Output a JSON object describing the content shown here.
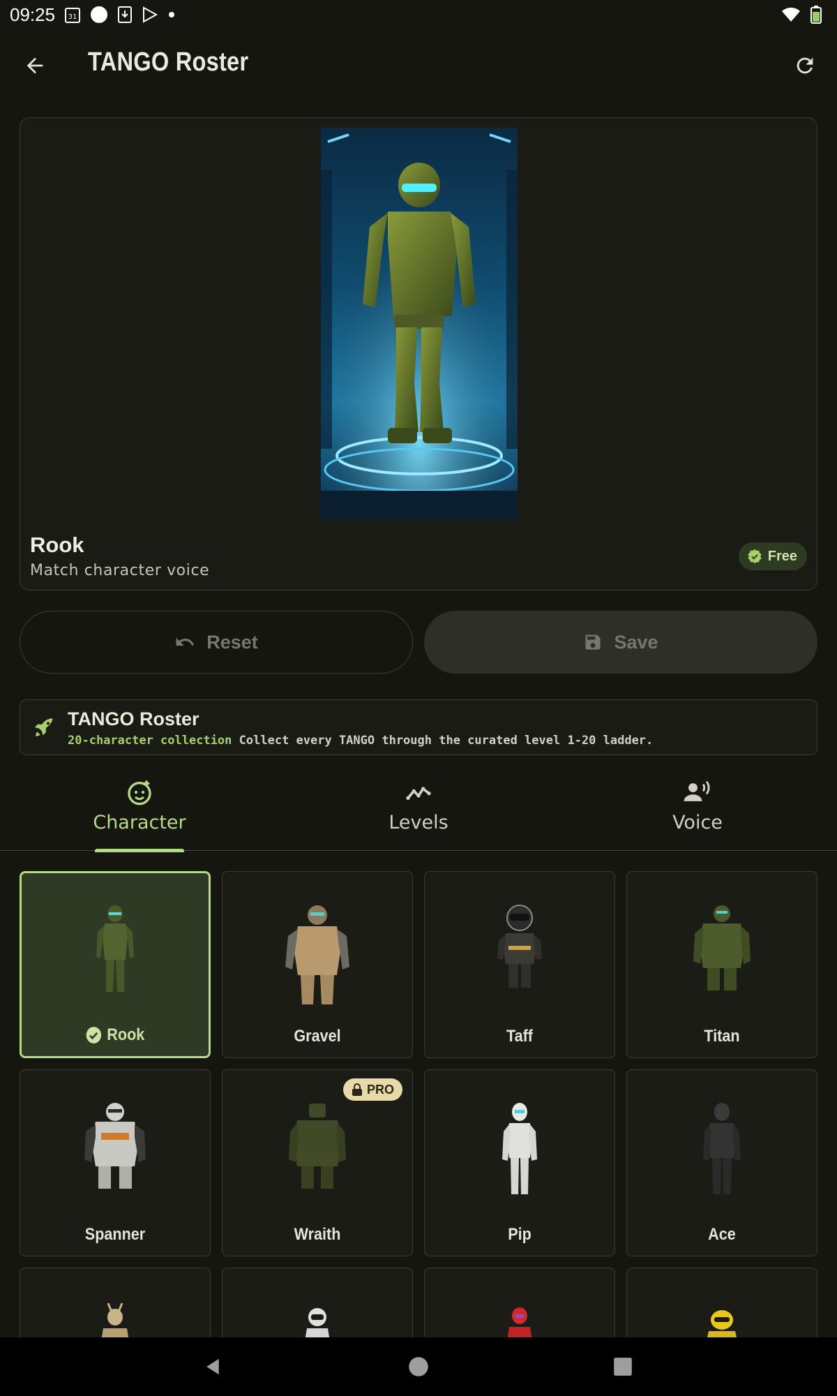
{
  "status_bar": {
    "time": "09:25",
    "icons": [
      "calendar-icon",
      "circle-icon",
      "download-icon",
      "play-store-icon",
      "dot-icon",
      "wifi-icon",
      "battery-icon"
    ]
  },
  "app_bar": {
    "title": "TANGO Roster",
    "back_icon": "arrow-left-icon",
    "refresh_icon": "refresh-icon"
  },
  "hero": {
    "name": "Rook",
    "subtitle": "Match character voice",
    "badge": "Free"
  },
  "actions": {
    "reset_label": "Reset",
    "save_label": "Save"
  },
  "banner": {
    "title": "TANGO Roster",
    "highlight": "20-character collection",
    "description": "Collect every TANGO through the curated level 1-20 ladder."
  },
  "tabs": [
    {
      "label": "Character",
      "icon": "face-icon",
      "active": true
    },
    {
      "label": "Levels",
      "icon": "trend-line-icon",
      "active": false
    },
    {
      "label": "Voice",
      "icon": "voice-icon",
      "active": false
    }
  ],
  "characters": [
    {
      "name": "Rook",
      "selected": true,
      "locked": false
    },
    {
      "name": "Gravel",
      "selected": false,
      "locked": false
    },
    {
      "name": "Taff",
      "selected": false,
      "locked": false
    },
    {
      "name": "Titan",
      "selected": false,
      "locked": false
    },
    {
      "name": "Spanner",
      "selected": false,
      "locked": false
    },
    {
      "name": "Wraith",
      "selected": false,
      "locked": true,
      "badge": "PRO"
    },
    {
      "name": "Pip",
      "selected": false,
      "locked": false
    },
    {
      "name": "Ace",
      "selected": false,
      "locked": false
    }
  ],
  "colors": {
    "accent": "#b7d98a",
    "background": "#15160f",
    "surface": "#1a1b14",
    "selected_card": "#2e3a24",
    "pro_badge": "#e8d9a8"
  }
}
